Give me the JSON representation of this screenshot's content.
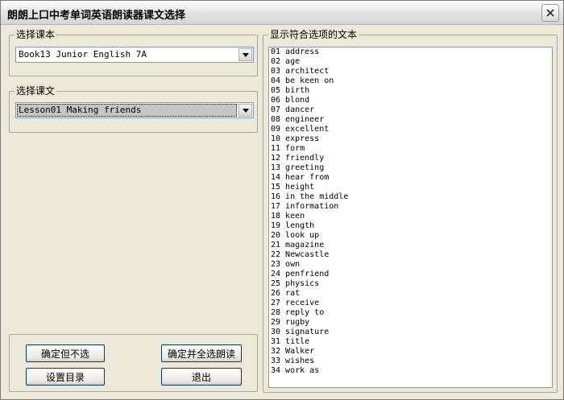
{
  "window": {
    "title": "朗朗上口中考单词英语朗读器课文选择"
  },
  "textbook_group": {
    "legend": "选择课本",
    "selected": "Book13 Junior English 7A"
  },
  "lesson_group": {
    "legend": "选择课文",
    "selected": "Lesson01 Making friends"
  },
  "text_group": {
    "legend": "显示符合选项的文本",
    "items": [
      "01 address",
      "02 age",
      "03 architect",
      "04 be keen on",
      "05 birth",
      "06 blond",
      "07 dancer",
      "08 engineer",
      "09 excellent",
      "10 express",
      "11 form",
      "12 friendly",
      "13 greeting",
      "14 hear from",
      "15 height",
      "16 in the middle",
      "17 information",
      "18 keen",
      "19 length",
      "20 look up",
      "21 magazine",
      "22 Newcastle",
      "23 own",
      "24 penfriend",
      "25 physics",
      "26 rat",
      "27 receive",
      "28 reply to",
      "29 rugby",
      "30 signature",
      "31 title",
      "32 Walker",
      "33 wishes",
      "34 work as"
    ]
  },
  "buttons": {
    "confirm_no_select": "确定但不选",
    "confirm_select_all": "确定并全选朗读",
    "set_directory": "设置目录",
    "exit": "退出"
  }
}
